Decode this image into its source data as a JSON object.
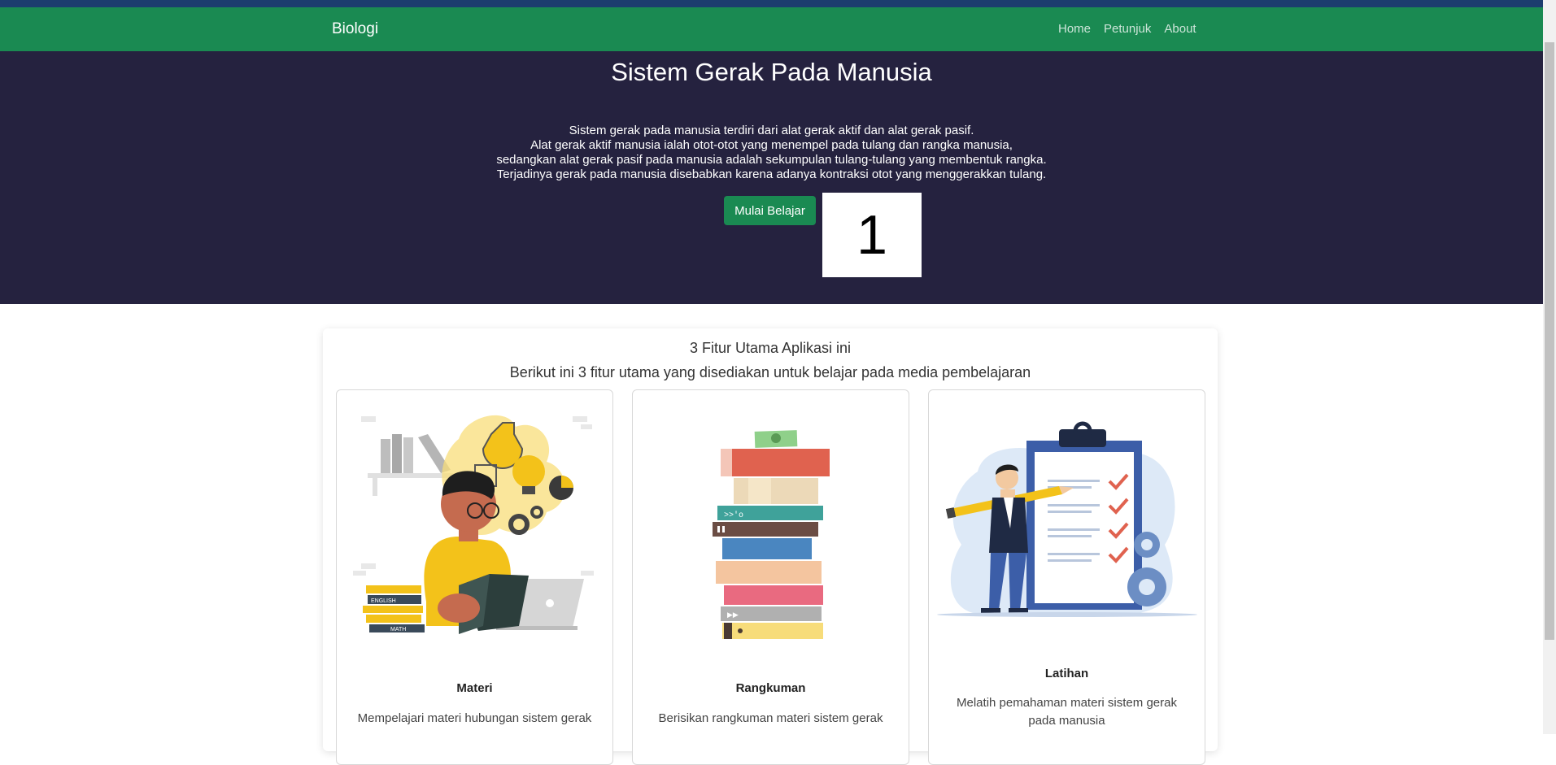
{
  "navbar": {
    "brand": "Biologi",
    "links": [
      "Home",
      "Petunjuk",
      "About"
    ]
  },
  "hero": {
    "title": "Sistem Gerak Pada Manusia",
    "lines": [
      "Sistem gerak pada manusia terdiri dari alat gerak aktif dan alat gerak pasif.",
      "Alat gerak aktif manusia ialah otot-otot yang menempel pada tulang dan rangka manusia,",
      "sedangkan alat gerak pasif pada manusia adalah sekumpulan tulang-tulang yang membentuk rangka.",
      "Terjadinya gerak pada manusia disebabkan karena adanya kontraksi otot yang menggerakkan tulang."
    ],
    "button_label": "Mulai Belajar",
    "counter": "1"
  },
  "features": {
    "title": "3 Fitur Utama Aplikasi ini",
    "subtitle": "Berikut ini 3 fitur utama yang disediakan untuk belajar pada media pembelajaran",
    "cards": [
      {
        "title": "Materi",
        "desc": "Mempelajari materi hubungan sistem gerak",
        "illustration": "student-reading-illustration",
        "book_labels": [
          "ENGLISH",
          "MATH"
        ]
      },
      {
        "title": "Rangkuman",
        "desc": "Berisikan rangkuman materi sistem gerak",
        "illustration": "book-stack-illustration"
      },
      {
        "title": "Latihan",
        "desc": "Melatih pemahaman materi sistem gerak pada manusia",
        "illustration": "clipboard-checklist-illustration"
      }
    ]
  },
  "colors": {
    "navbar": "#1a8a52",
    "hero": "#25223f",
    "top_strip": "#1c3d6e"
  }
}
